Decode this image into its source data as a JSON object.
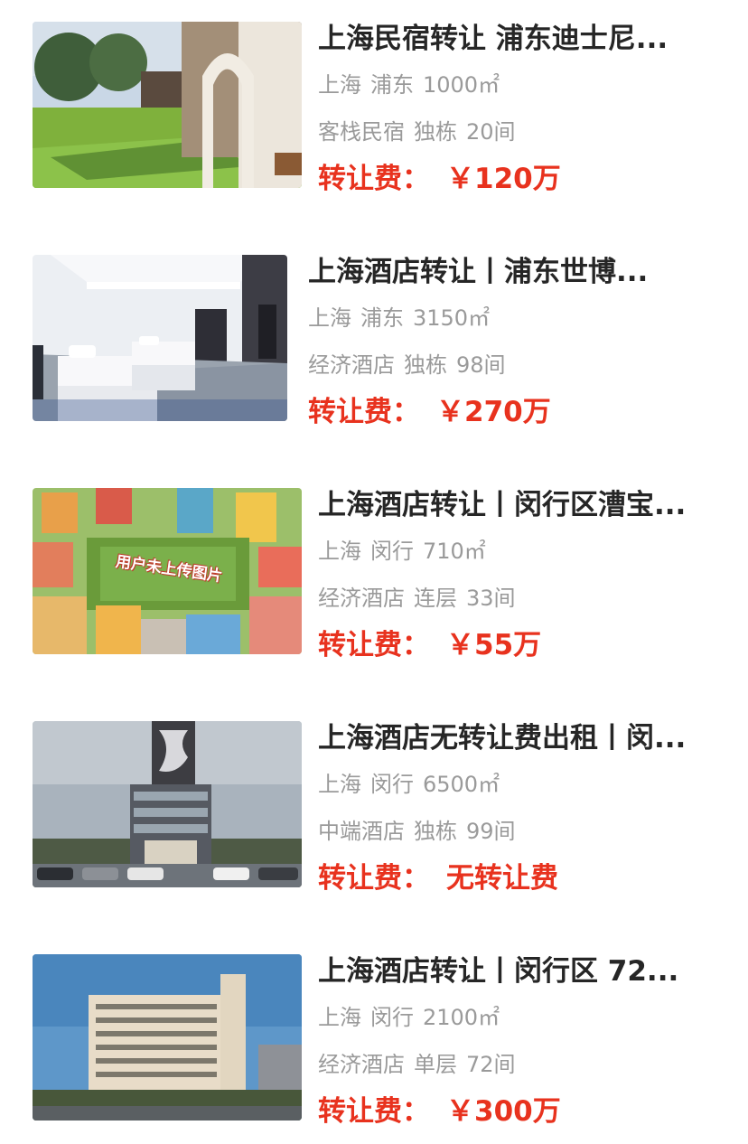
{
  "listings": [
    {
      "title": "上海民宿转让 浦东迪士尼...",
      "city": "上海",
      "district": "浦东",
      "area": "1000㎡",
      "type": "客栈民宿",
      "building": "独栋",
      "rooms": "20间",
      "fee_label": "转让费：",
      "fee_value": "￥120万",
      "image": "guesthouse-courtyard-arch"
    },
    {
      "title": "上海酒店转让丨浦东世博...",
      "city": "上海",
      "district": "浦东",
      "area": "3150㎡",
      "type": "经济酒店",
      "building": "独栋",
      "rooms": "98间",
      "fee_label": "转让费：",
      "fee_value": "￥270万",
      "image": "hotel-twin-bedroom"
    },
    {
      "title": "上海酒店转让丨闵行区漕宝...",
      "city": "上海",
      "district": "闵行",
      "area": "710㎡",
      "type": "经济酒店",
      "building": "连层",
      "rooms": "33间",
      "fee_label": "转让费：",
      "fee_value": "￥55万",
      "image": "placeholder-town-illustration",
      "image_caption": "用户未上传图片"
    },
    {
      "title": "上海酒店无转让费出租丨闵...",
      "city": "上海",
      "district": "闵行",
      "area": "6500㎡",
      "type": "中端酒店",
      "building": "独栋",
      "rooms": "99间",
      "fee_label": "转让费：",
      "fee_value": "无转让费",
      "image": "hotel-tower-exterior"
    },
    {
      "title": "上海酒店转让丨闵行区 72...",
      "city": "上海",
      "district": "闵行",
      "area": "2100㎡",
      "type": "经济酒店",
      "building": "单层",
      "rooms": "72间",
      "fee_label": "转让费：",
      "fee_value": "￥300万",
      "image": "hotel-building-exterior"
    }
  ],
  "colors": {
    "title": "#262626",
    "meta": "#9a9a9a",
    "price": "#e8321e"
  }
}
